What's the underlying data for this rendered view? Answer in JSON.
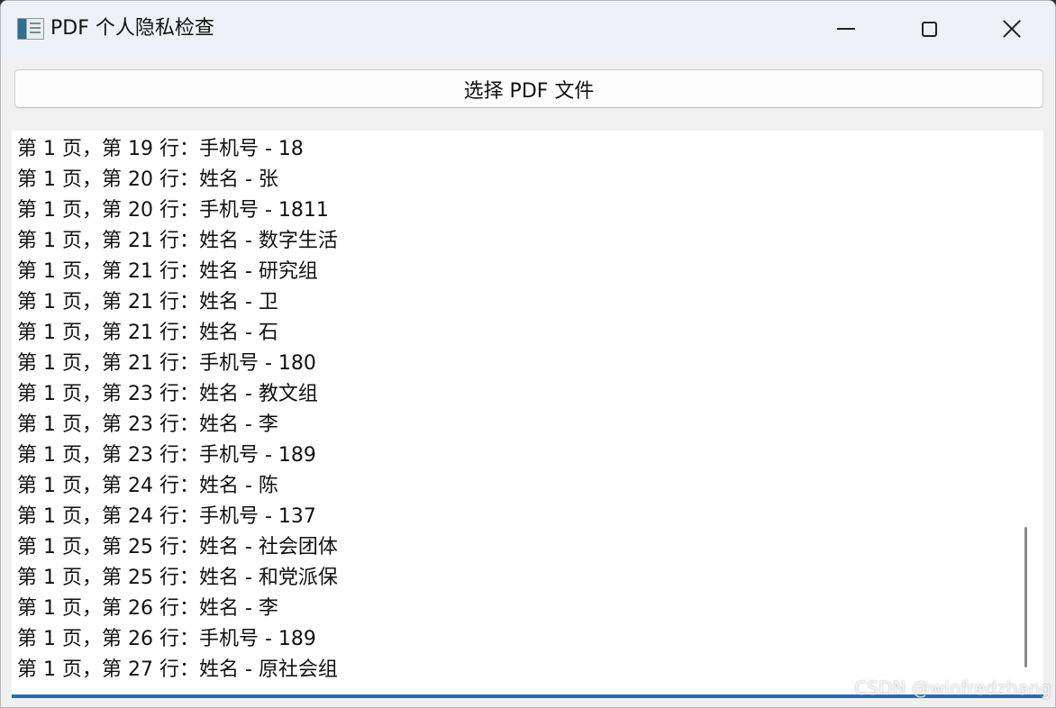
{
  "window": {
    "title": "PDF 个人隐私检查",
    "icon": "app-window-icon"
  },
  "controls": {
    "minimize_icon": "minimize-icon",
    "maximize_icon": "maximize-icon",
    "close_icon": "close-icon"
  },
  "toolbar": {
    "select_label": "选择 PDF 文件"
  },
  "results": [
    "第 1 页，第 19 行：手机号 - 18",
    "第 1 页，第 20 行：姓名 - 张",
    "第 1 页，第 20 行：手机号 - 1811",
    "第 1 页，第 21 行：姓名 - 数字生活",
    "第 1 页，第 21 行：姓名 - 研究组",
    "第 1 页，第 21 行：姓名 - 卫",
    "第 1 页，第 21 行：姓名 - 石",
    "第 1 页，第 21 行：手机号 - 180",
    "第 1 页，第 23 行：姓名 - 教文组",
    "第 1 页，第 23 行：姓名 - 李",
    "第 1 页，第 23 行：手机号 - 189",
    "第 1 页，第 24 行：姓名 - 陈",
    "第 1 页，第 24 行：手机号 - 137",
    "第 1 页，第 25 行：姓名 - 社会团体",
    "第 1 页，第 25 行：姓名 - 和党派保",
    "第 1 页，第 26 行：姓名 - 李",
    "第 1 页，第 26 行：手机号 - 189",
    "第 1 页，第 27 行：姓名 - 原社会组"
  ],
  "watermark": "CSDN @winfredzhang",
  "colors": {
    "accent": "#1f6fc1",
    "titlebar": "#eef1f8",
    "window_bg": "#f0f0f0"
  }
}
